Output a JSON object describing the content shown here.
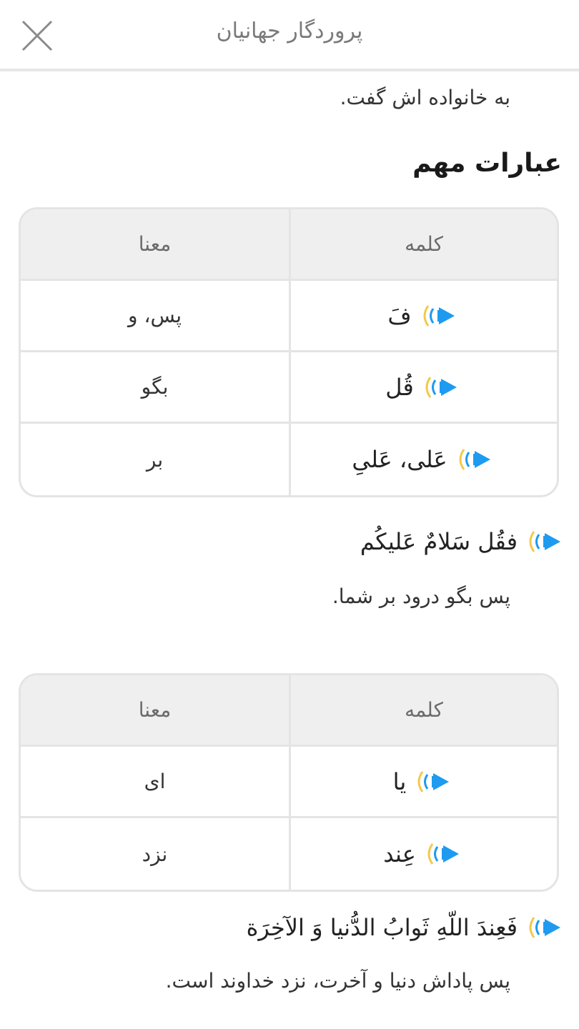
{
  "header": {
    "title": "پروردگار جهانیان",
    "close_icon": "close-icon"
  },
  "intro_text": "به خانواده اش گفت.",
  "section_title": "عبارات مهم",
  "table1": {
    "col_word": "کلمه",
    "col_meaning": "معنا",
    "rows": [
      {
        "word": "فَ",
        "meaning": "پس، و"
      },
      {
        "word": "قُل",
        "meaning": "بگو"
      },
      {
        "word": "عَلی، عَلیِ",
        "meaning": "بر"
      }
    ]
  },
  "verse1": {
    "text": "فقُل سَلامٌ عَلیکُم",
    "translation": "پس بگو درود بر شما."
  },
  "table2": {
    "col_word": "کلمه",
    "col_meaning": "معنا",
    "rows": [
      {
        "word": "یا",
        "meaning": "ای"
      },
      {
        "word": "عِند",
        "meaning": "نزد"
      }
    ]
  },
  "verse2": {
    "text": "فَعِندَ اللّهِ ثَوابُ الدُّنیا وَ الآخِرَة",
    "translation": "پس پاداش دنیا و آخرت، نزد خداوند است."
  },
  "colors": {
    "accent": "#1e9bf0",
    "border": "#e4e4e4",
    "header_bg": "#efefef"
  }
}
